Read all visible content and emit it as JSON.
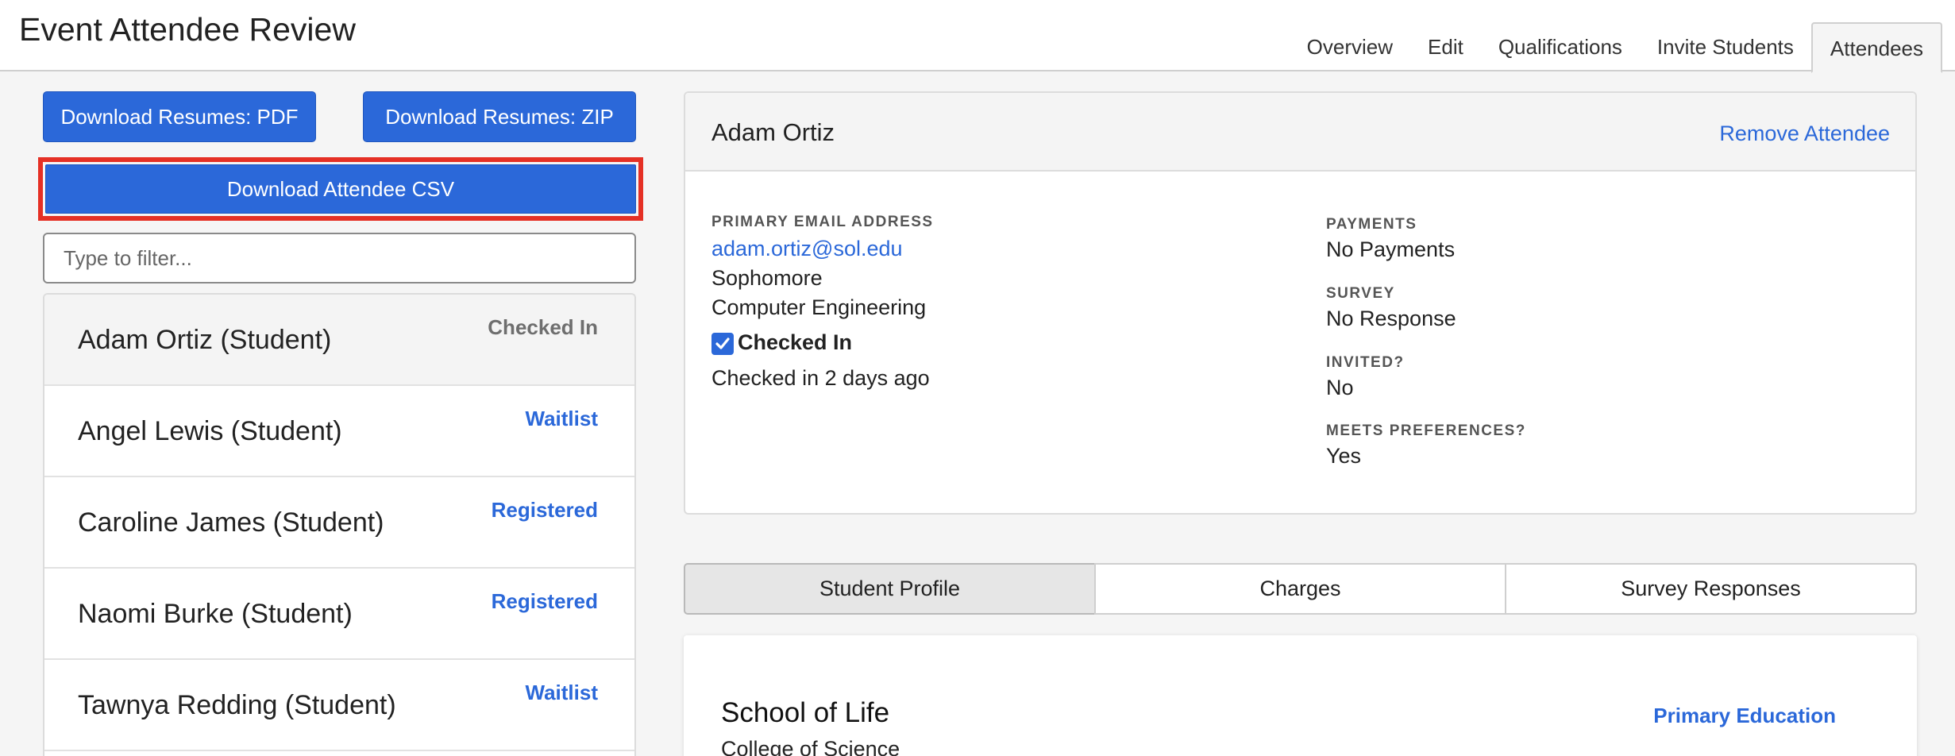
{
  "header": {
    "title": "Event Attendee Review",
    "tabs": [
      {
        "label": "Overview"
      },
      {
        "label": "Edit"
      },
      {
        "label": "Qualifications"
      },
      {
        "label": "Invite Students"
      },
      {
        "label": "Attendees"
      }
    ],
    "active_tab": "Attendees"
  },
  "left_panel": {
    "download_pdf_label": "Download Resumes: PDF",
    "download_zip_label": "Download Resumes: ZIP",
    "download_csv_label": "Download Attendee CSV",
    "filter_placeholder": "Type to filter...",
    "attendees": [
      {
        "name": "Adam Ortiz (Student)",
        "status": "Checked In"
      },
      {
        "name": "Angel Lewis (Student)",
        "status": "Waitlist"
      },
      {
        "name": "Caroline James (Student)",
        "status": "Registered"
      },
      {
        "name": "Naomi Burke (Student)",
        "status": "Registered"
      },
      {
        "name": "Tawnya Redding (Student)",
        "status": "Waitlist"
      }
    ]
  },
  "detail": {
    "name": "Adam Ortiz",
    "remove_label": "Remove Attendee",
    "email_label": "PRIMARY EMAIL ADDRESS",
    "email": "adam.ortiz@sol.edu",
    "year": "Sophomore",
    "major": "Computer Engineering",
    "checked_in_label": "Checked In",
    "checked_in_time": "Checked in 2 days ago",
    "payments_label": "PAYMENTS",
    "payments_value": "No Payments",
    "survey_label": "SURVEY",
    "survey_value": "No Response",
    "invited_label": "INVITED?",
    "invited_value": "No",
    "preferences_label": "MEETS PREFERENCES?",
    "preferences_value": "Yes"
  },
  "profile_tabs": [
    {
      "label": "Student Profile"
    },
    {
      "label": "Charges"
    },
    {
      "label": "Survey Responses"
    }
  ],
  "profile": {
    "school": "School of Life",
    "college": "College of Science",
    "education_badge": "Primary Education"
  },
  "colors": {
    "accent": "#2b68d9",
    "highlight": "#e53025"
  }
}
